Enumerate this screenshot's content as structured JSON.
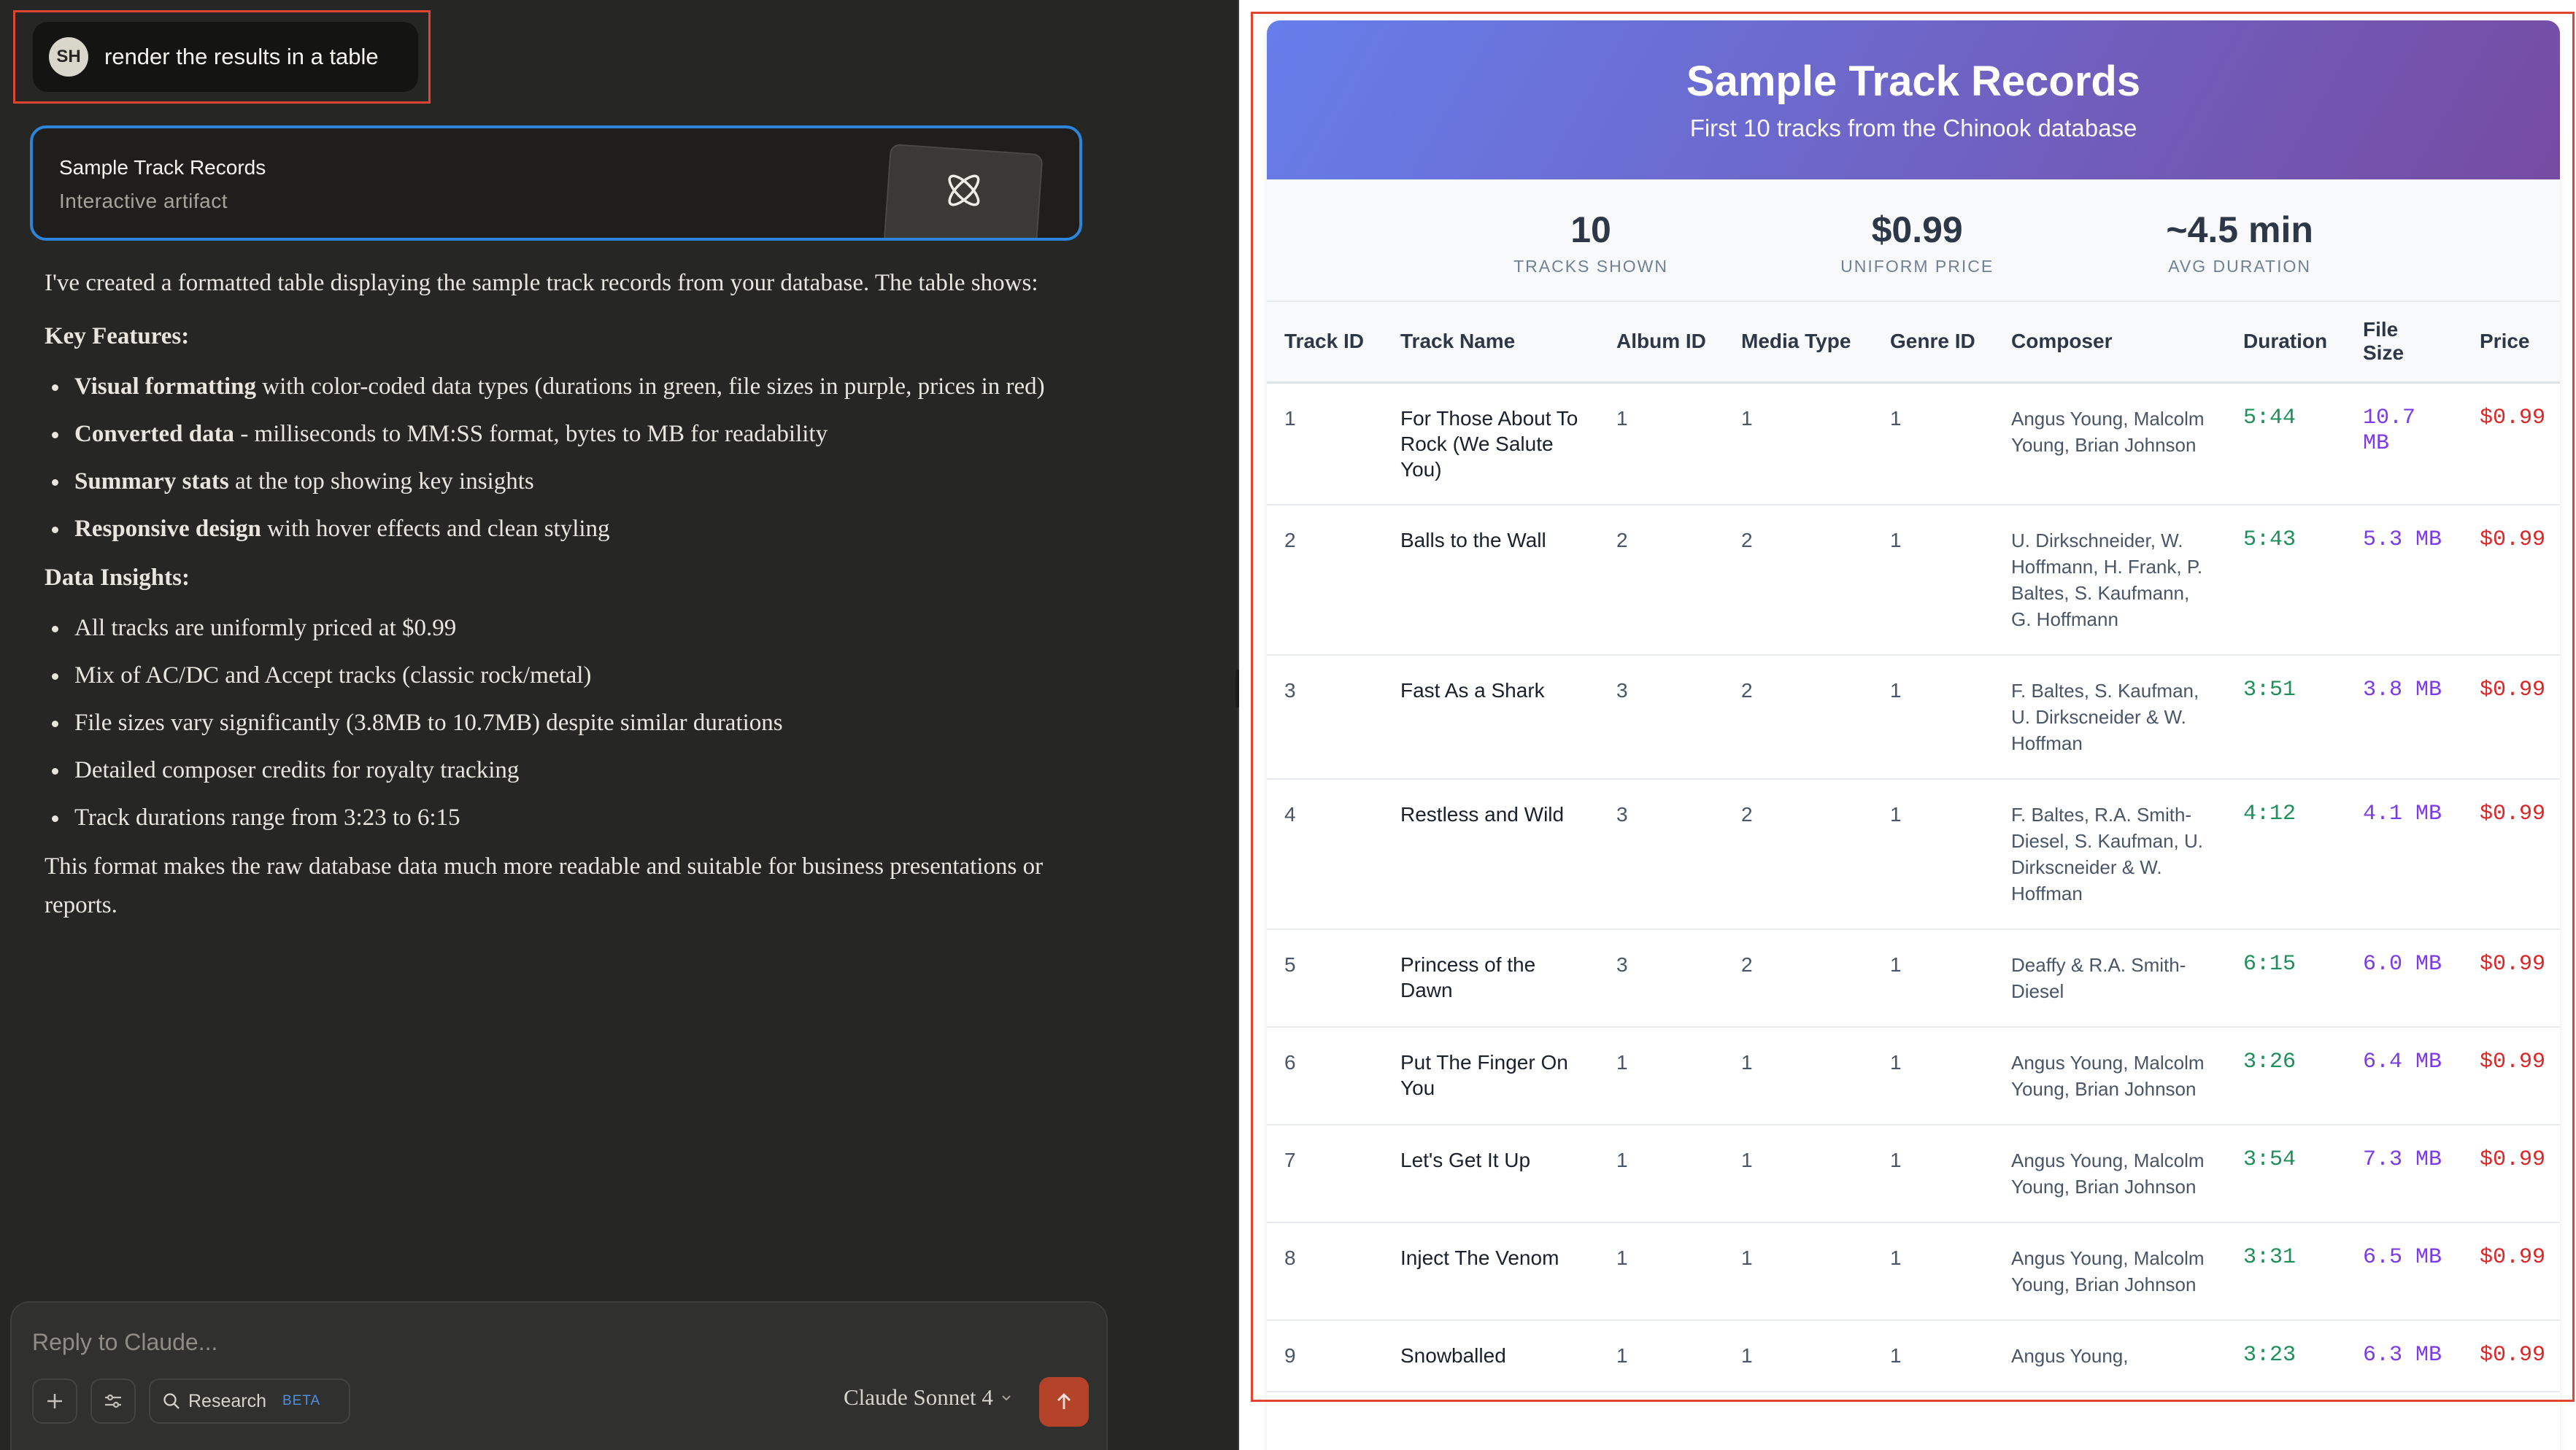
{
  "user_message": {
    "avatar": "SH",
    "text": "render the results in a table"
  },
  "artifact_card": {
    "title": "Sample Track Records",
    "subtitle": "Interactive artifact"
  },
  "response": {
    "intro": "I've created a formatted table displaying the sample track records from your database. The table shows:",
    "features_heading": "Key Features:",
    "features": [
      {
        "bold": "Visual formatting",
        "text": " with color-coded data types (durations in green, file sizes in purple, prices in red)"
      },
      {
        "bold": "Converted data",
        "text": " - milliseconds to MM:SS format, bytes to MB for readability"
      },
      {
        "bold": "Summary stats",
        "text": " at the top showing key insights"
      },
      {
        "bold": "Responsive design",
        "text": " with hover effects and clean styling"
      }
    ],
    "insights_heading": "Data Insights:",
    "insights": [
      "All tracks are uniformly priced at $0.99",
      "Mix of AC/DC and Accept tracks (classic rock/metal)",
      "File sizes vary significantly (3.8MB to 10.7MB) despite similar durations",
      "Detailed composer credits for royalty tracking",
      "Track durations range from 3:23 to 6:15"
    ],
    "closing": "This format makes the raw database data much more readable and suitable for business presentations or reports."
  },
  "composer": {
    "placeholder": "Reply to Claude...",
    "research_label": "Research",
    "beta_label": "BETA",
    "model": "Claude Sonnet 4"
  },
  "artifact": {
    "title": "Sample Track Records",
    "subtitle": "First 10 tracks from the Chinook database",
    "stats": [
      {
        "value": "10",
        "label": "TRACKS SHOWN"
      },
      {
        "value": "$0.99",
        "label": "UNIFORM PRICE"
      },
      {
        "value": "~4.5 min",
        "label": "AVG DURATION"
      }
    ],
    "columns": [
      "Track ID",
      "Track Name",
      "Album ID",
      "Media Type",
      "Genre ID",
      "Composer",
      "Duration",
      "File Size",
      "Price"
    ],
    "rows": [
      {
        "id": "1",
        "name": "For Those About To Rock (We Salute You)",
        "album": "1",
        "media": "1",
        "genre": "1",
        "composer": "Angus Young, Malcolm Young, Brian Johnson",
        "duration": "5:44",
        "size": "10.7 MB",
        "price": "$0.99"
      },
      {
        "id": "2",
        "name": "Balls to the Wall",
        "album": "2",
        "media": "2",
        "genre": "1",
        "composer": "U. Dirkschneider, W. Hoffmann, H. Frank, P. Baltes, S. Kaufmann, G. Hoffmann",
        "duration": "5:43",
        "size": "5.3 MB",
        "price": "$0.99"
      },
      {
        "id": "3",
        "name": "Fast As a Shark",
        "album": "3",
        "media": "2",
        "genre": "1",
        "composer": "F. Baltes, S. Kaufman, U. Dirkscneider & W. Hoffman",
        "duration": "3:51",
        "size": "3.8 MB",
        "price": "$0.99"
      },
      {
        "id": "4",
        "name": "Restless and Wild",
        "album": "3",
        "media": "2",
        "genre": "1",
        "composer": "F. Baltes, R.A. Smith-Diesel, S. Kaufman, U. Dirkscneider & W. Hoffman",
        "duration": "4:12",
        "size": "4.1 MB",
        "price": "$0.99"
      },
      {
        "id": "5",
        "name": "Princess of the Dawn",
        "album": "3",
        "media": "2",
        "genre": "1",
        "composer": "Deaffy & R.A. Smith-Diesel",
        "duration": "6:15",
        "size": "6.0 MB",
        "price": "$0.99"
      },
      {
        "id": "6",
        "name": "Put The Finger On You",
        "album": "1",
        "media": "1",
        "genre": "1",
        "composer": "Angus Young, Malcolm Young, Brian Johnson",
        "duration": "3:26",
        "size": "6.4 MB",
        "price": "$0.99"
      },
      {
        "id": "7",
        "name": "Let's Get It Up",
        "album": "1",
        "media": "1",
        "genre": "1",
        "composer": "Angus Young, Malcolm Young, Brian Johnson",
        "duration": "3:54",
        "size": "7.3 MB",
        "price": "$0.99"
      },
      {
        "id": "8",
        "name": "Inject The Venom",
        "album": "1",
        "media": "1",
        "genre": "1",
        "composer": "Angus Young, Malcolm Young, Brian Johnson",
        "duration": "3:31",
        "size": "6.5 MB",
        "price": "$0.99"
      },
      {
        "id": "9",
        "name": "Snowballed",
        "album": "1",
        "media": "1",
        "genre": "1",
        "composer": "Angus Young,",
        "duration": "3:23",
        "size": "6.3 MB",
        "price": "$0.99"
      }
    ]
  }
}
